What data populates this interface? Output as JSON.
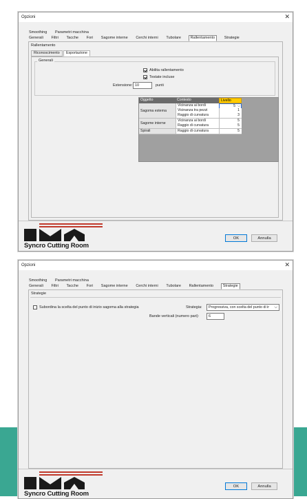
{
  "window1": {
    "title": "Opzioni",
    "close_icon": "close-icon",
    "tabs_row1": [
      "Smoothing",
      "Parametri macchina"
    ],
    "tabs_row2": [
      "Generali",
      "Filtri",
      "Tacche",
      "Fori",
      "Sagome interne",
      "Cerchi interni",
      "Tubolare",
      "Rallentamento",
      "Strategie"
    ],
    "active_tab": "Rallentamento",
    "section_label": "Rallentamento",
    "subtabs": [
      "Riconoscimento",
      "Esportazione"
    ],
    "active_subtab": "Esportazione",
    "group_label": "Generali",
    "check_slowdown": "Abilita rallentamento",
    "check_slowdown_checked": true,
    "check_heads": "Testate incluse",
    "check_heads_checked": true,
    "extension_label": "Estensione:",
    "extension_value": "10",
    "extension_unit": "punti",
    "grid": {
      "headers": [
        "Oggetto",
        "Contesto",
        "Livello"
      ],
      "rows": [
        {
          "context": "Vicinanza ai bordi",
          "value": "5"
        },
        {
          "context": "Vicinanza tra pezzi",
          "value": "1"
        },
        {
          "context": "Raggio di curvatura",
          "value": "3"
        },
        {
          "context": "Vicinanza ai bordi",
          "value": "5"
        },
        {
          "context": "Raggio di curvatura",
          "value": "5"
        },
        {
          "context": "Raggio di curvatura",
          "value": "5"
        }
      ],
      "objects": [
        "Sagoma esterna",
        "Sagome interne",
        "Spirali"
      ],
      "dropdown_icon": "chevron-down-icon"
    },
    "brand": "Syncro Cutting Room",
    "ok_label": "OK",
    "cancel_label": "Annulla"
  },
  "window2": {
    "title": "Opzioni",
    "close_icon": "close-icon",
    "tabs_row1": [
      "Smoothing",
      "Parametri macchina"
    ],
    "tabs_row2": [
      "Generali",
      "Filtri",
      "Tacche",
      "Fori",
      "Sagome interne",
      "Cerchi interni",
      "Tubolare",
      "Rallentamento",
      "Strategie"
    ],
    "active_tab": "Strategie",
    "section_label": "Strategie",
    "check_subordinate": "Subordina la scelta del punto di inizio sagoma alla strategia",
    "check_subordinate_checked": false,
    "strategy_label": "Strategia:",
    "strategy_value": "Progressiva, con scelta del punto di ir",
    "bands_label": "Bande verticali (numero pari):",
    "bands_value": "6",
    "brand": "Syncro Cutting Room",
    "ok_label": "OK",
    "cancel_label": "Annulla"
  },
  "colors": {
    "accent_teal": "#3aa792",
    "header_selected": "#ffcc00",
    "grid_header": "#6b6b6b",
    "brand_red": "#c0392b"
  }
}
